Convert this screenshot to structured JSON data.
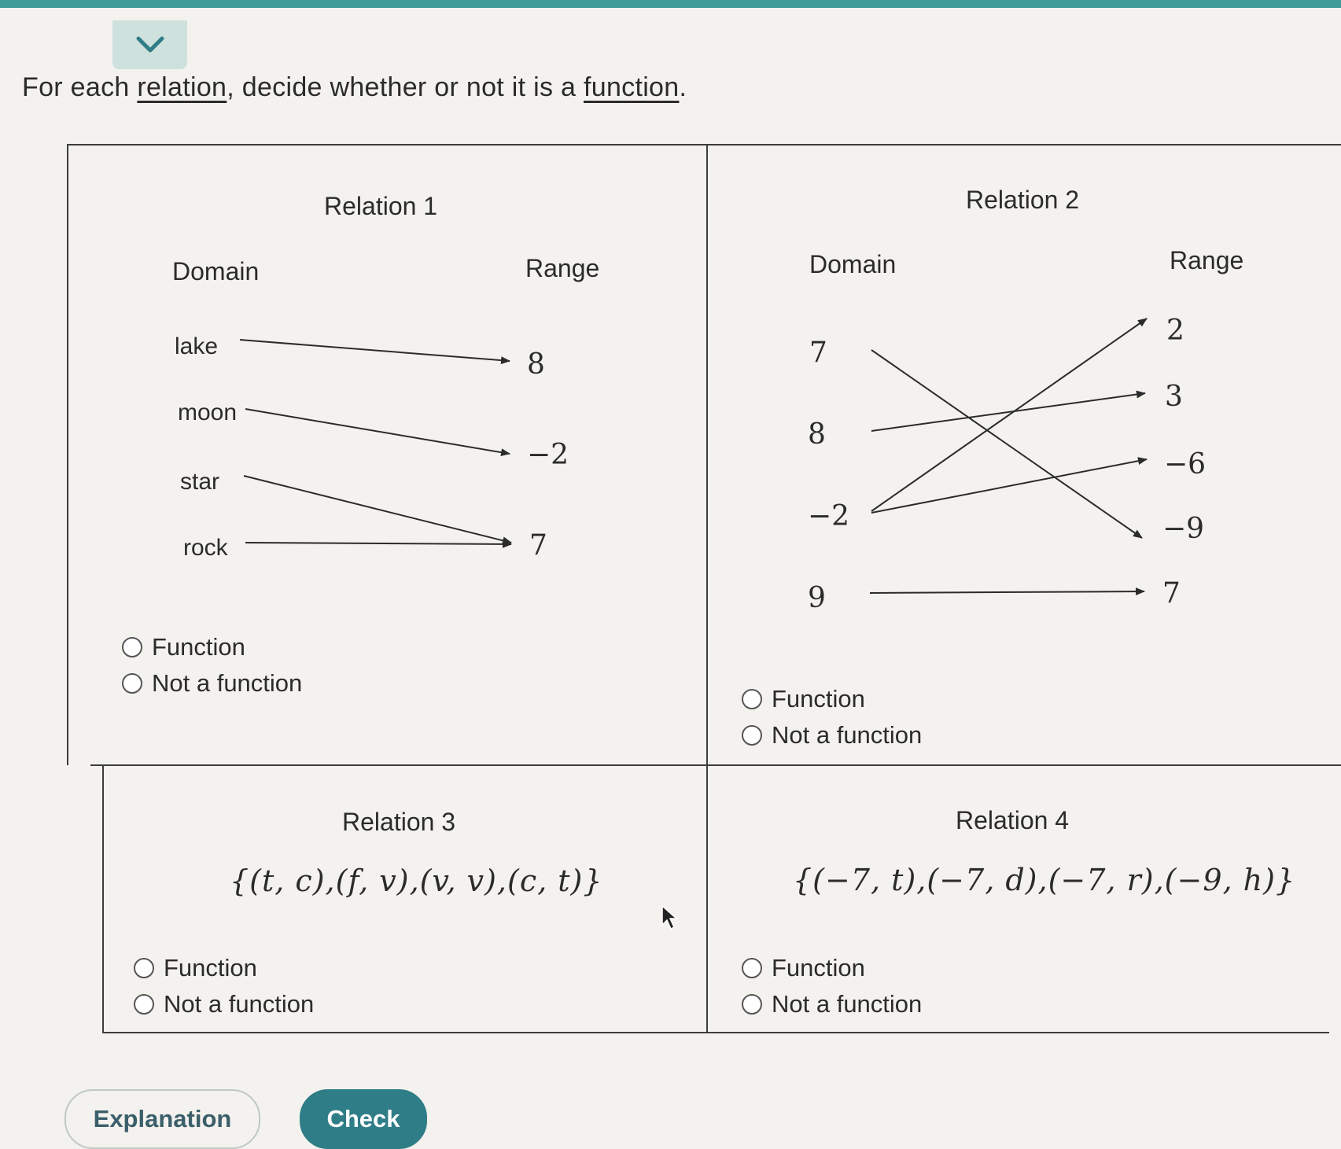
{
  "prompt": {
    "before": "For each ",
    "term1": "relation",
    "middle": ", decide whether or not it is a ",
    "term2": "function",
    "after": "."
  },
  "relations": [
    {
      "title": "Relation 1",
      "domain_label": "Domain",
      "range_label": "Range",
      "domain": [
        "lake",
        "moon",
        "star",
        "rock"
      ],
      "range": [
        "8",
        "−2",
        "7"
      ],
      "mapping": [
        [
          "lake",
          "8"
        ],
        [
          "moon",
          "−2"
        ],
        [
          "star",
          "7"
        ],
        [
          "rock",
          "7"
        ]
      ]
    },
    {
      "title": "Relation 2",
      "domain_label": "Domain",
      "range_label": "Range",
      "domain": [
        "7",
        "8",
        "−2",
        "9"
      ],
      "range": [
        "2",
        "3",
        "−6",
        "−9",
        "7"
      ],
      "mapping": [
        [
          "7",
          "−9"
        ],
        [
          "8",
          "3"
        ],
        [
          "−2",
          "2"
        ],
        [
          "−2",
          "−6"
        ],
        [
          "9",
          "7"
        ]
      ]
    },
    {
      "title": "Relation 3",
      "set": "{(t, c),(f, v),(v, v),(c, t)}"
    },
    {
      "title": "Relation 4",
      "set": "{(−7, t),(−7, d),(−7, r),(−9, h)}"
    }
  ],
  "options": {
    "function": "Function",
    "not_function": "Not a function"
  },
  "buttons": {
    "explanation": "Explanation",
    "check": "Check"
  }
}
